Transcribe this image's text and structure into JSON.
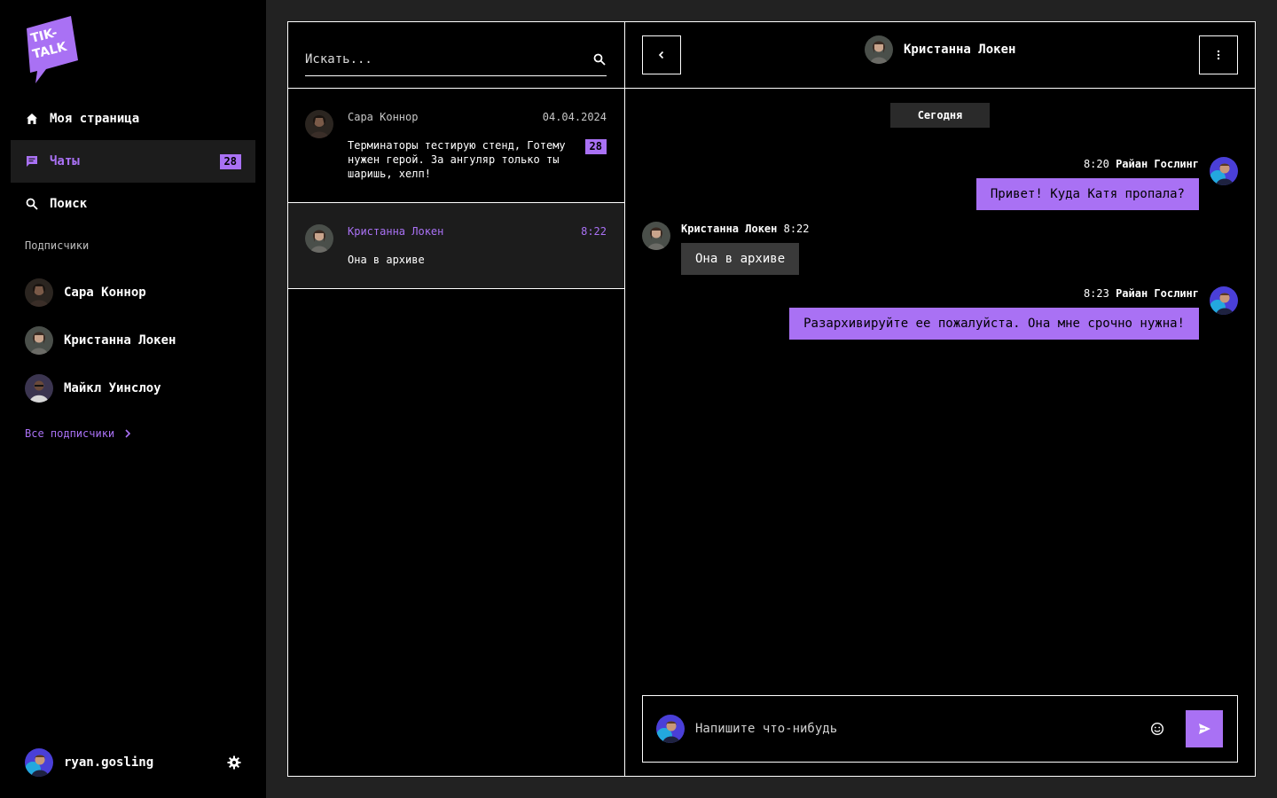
{
  "app": {
    "logo_text": "TIK-TALK"
  },
  "colors": {
    "accent": "#a971f4",
    "bg": "#000000",
    "page": "#222222"
  },
  "nav": [
    {
      "label": "Моя страница",
      "icon": "home-icon"
    },
    {
      "label": "Чаты",
      "icon": "chat-icon",
      "badge": "28",
      "active": true
    },
    {
      "label": "Поиск",
      "icon": "search-icon"
    }
  ],
  "subscribers": {
    "title": "Подписчики",
    "items": [
      {
        "name": "Сара Коннор"
      },
      {
        "name": "Кристанна Локен"
      },
      {
        "name": "Майкл Уинслоу"
      }
    ],
    "all_label": "Все подписчики"
  },
  "profile": {
    "username": "ryan.gosling"
  },
  "search": {
    "placeholder": "Искать..."
  },
  "chats": [
    {
      "name": "Сара Коннор",
      "time": "04.04.2024",
      "message": "Терминаторы тестирую стенд, Готему нужен герой. За ангуляр только ты шаришь, хелп!",
      "badge": "28"
    },
    {
      "name": "Кристанна Локен",
      "time": "8:22",
      "message": "Она в архиве",
      "active": true
    }
  ],
  "conversation": {
    "title": "Кристанна Локен",
    "date_label": "Сегодня",
    "messages": [
      {
        "direction": "out",
        "time": "8:20",
        "author": "Райан Гослинг",
        "text": "Привет! Куда Катя пропала?"
      },
      {
        "direction": "in",
        "time": "8:22",
        "author": "Кристанна Локен",
        "text": "Она в архиве"
      },
      {
        "direction": "out",
        "time": "8:23",
        "author": "Райан Гослинг",
        "text": "Разархивируйте ее пожалуйста. Она мне срочно нужна!"
      }
    ],
    "composer_placeholder": "Напишите что-нибудь"
  }
}
